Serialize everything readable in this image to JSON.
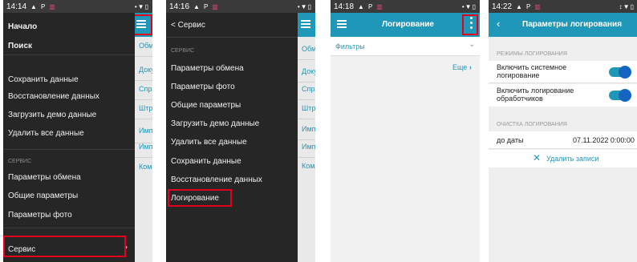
{
  "colors": {
    "accent": "#1f97b8",
    "highlight": "#e2001a",
    "drawer": "#262626"
  },
  "phone1": {
    "status_time": "14:14",
    "drawer": {
      "start": "Начало",
      "search": "Поиск",
      "items": [
        "Сохранить данные",
        "Восстановление данных",
        "Загрузить демо данные",
        "Удалить все данные"
      ],
      "section": "СЕРВИС",
      "service_items": [
        "Параметры обмена",
        "Общие параметры",
        "Параметры фото"
      ],
      "bottom": "Сервис",
      "bottom_chevron": "chevron-right-icon"
    },
    "behind": [
      "Обме",
      "Доку",
      "Спра",
      "Штри",
      "Импс",
      "Импс",
      "Кома"
    ]
  },
  "phone2": {
    "status_time": "14:16",
    "back_label": "< Сервис",
    "section": "СЕРВИС",
    "items": [
      "Параметры обмена",
      "Параметры фото",
      "Общие параметры",
      "Загрузить демо данные",
      "Удалить все данные",
      "Сохранить данные",
      "Восстановление данных",
      "Логирование"
    ],
    "behind": [
      "Обме",
      "Доку",
      "Спра",
      "Штри",
      "Импс",
      "Импс",
      "Кома"
    ]
  },
  "phone3": {
    "status_time": "14:18",
    "title": "Логирование",
    "filters": "Фильтры",
    "more": "Еще"
  },
  "phone4": {
    "status_time": "14:22",
    "title": "Параметры логирования",
    "section1": "РЕЖИМЫ ЛОГИРОВАНИЯ",
    "toggle1_line1": "Включить системное",
    "toggle1_line2": "логирование",
    "toggle2_line1": "Включить логирование",
    "toggle2_line2": "обработчиков",
    "section2": "ОЧИСТКА ЛОГИРОВАНИЯ",
    "date_label": "до даты",
    "date_value": "07.11.2022 0:00:00",
    "delete_label": "Удалить записи",
    "toggle1_on": true,
    "toggle2_on": true
  }
}
